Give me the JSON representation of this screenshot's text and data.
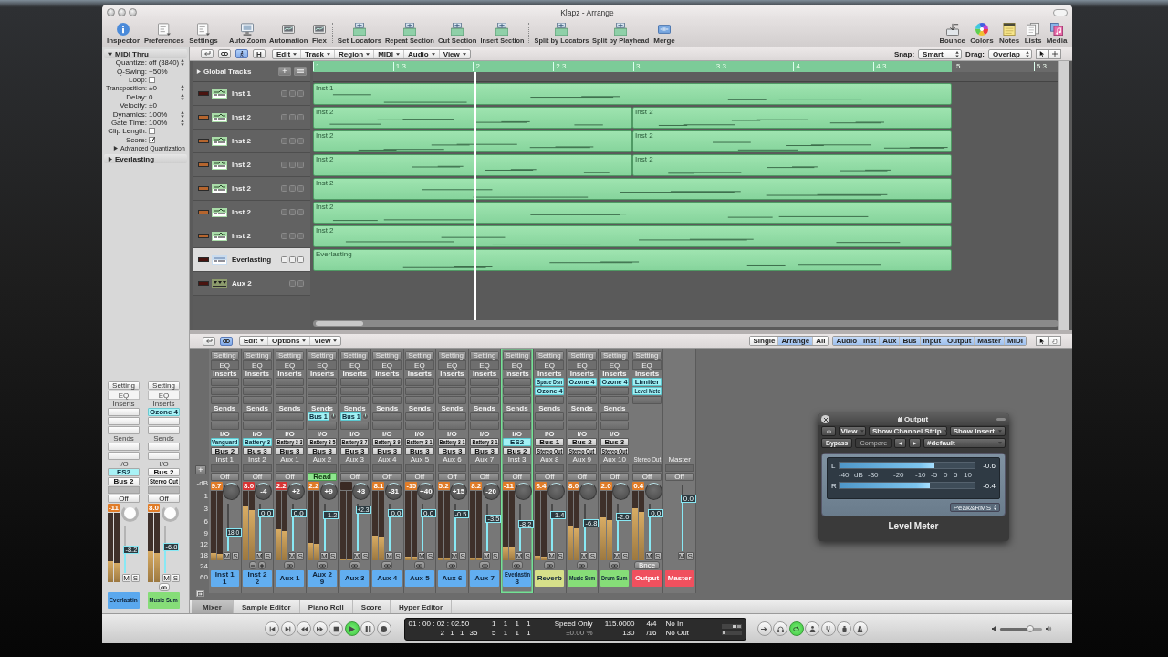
{
  "window": {
    "title": "Klapz - Arrange"
  },
  "toolbar": {
    "groups": [
      [
        {
          "label": "Inspector",
          "kind": "info"
        },
        {
          "label": "Preferences",
          "kind": "page"
        },
        {
          "label": "Settings",
          "kind": "page"
        }
      ],
      [
        {
          "label": "Auto Zoom",
          "kind": "monitor"
        },
        {
          "label": "Automation",
          "kind": "screen"
        },
        {
          "label": "Flex",
          "kind": "screen"
        }
      ],
      [
        {
          "label": "Set Locators",
          "kind": "ruler"
        },
        {
          "label": "Repeat Section",
          "kind": "ruler"
        },
        {
          "label": "Cut Section",
          "kind": "ruler"
        },
        {
          "label": "Insert Section",
          "kind": "ruler"
        }
      ],
      [
        {
          "label": "Split by Locators",
          "kind": "ruler"
        },
        {
          "label": "Split by Playhead",
          "kind": "ruler"
        },
        {
          "label": "Merge",
          "kind": "block"
        }
      ]
    ],
    "right": [
      {
        "label": "Bounce",
        "kind": "tray"
      },
      {
        "label": "Colors",
        "kind": "wheel"
      },
      {
        "label": "Notes",
        "kind": "notepad"
      },
      {
        "label": "Lists",
        "kind": "pages"
      },
      {
        "label": "Media",
        "kind": "media"
      }
    ]
  },
  "inspector": {
    "region": {
      "title": "MIDI Thru",
      "expanded": true,
      "params": [
        {
          "kind": "value",
          "label": "Quantize:",
          "value": "off (3840)",
          "stepper": true
        },
        {
          "kind": "value",
          "label": "Q-Swing:",
          "value": "+50%",
          "stepper": false
        },
        {
          "kind": "check",
          "label": "Loop:",
          "checked": false
        },
        {
          "kind": "value",
          "label": "Transposition:",
          "value": "±0",
          "stepper": true
        },
        {
          "kind": "value",
          "label": "Delay:",
          "value": "0",
          "stepper": true
        },
        {
          "kind": "value",
          "label": "Velocity:",
          "value": "±0",
          "stepper": false
        },
        {
          "kind": "value",
          "label": "Dynamics:",
          "value": "100%",
          "stepper": true
        },
        {
          "kind": "value",
          "label": "Gate Time:",
          "value": "100%",
          "stepper": true
        },
        {
          "kind": "check",
          "label": "Clip Length:",
          "checked": false
        },
        {
          "kind": "check",
          "label": "Score:",
          "checked": true
        }
      ],
      "subsection": {
        "title": "Advanced Quantization",
        "expanded": false
      }
    },
    "track": {
      "title": "Everlasting",
      "expanded": false
    },
    "strips": [
      {
        "kind": "channel",
        "setting": "Setting",
        "eq": "EQ",
        "inserts_label": "Inserts",
        "sends_label": "Sends",
        "io_label": "I/O",
        "input": {
          "label": "ES2",
          "kind": "instrument"
        },
        "output": "Bus 2",
        "automation": {
          "label": "Off",
          "active": false
        },
        "peak": {
          "value": "-11",
          "clip": false
        },
        "meter": {
          "level": 0.3
        },
        "fader": {
          "value": "-8.2",
          "level": 0.5
        },
        "mute_solo": [
          "M",
          "S"
        ],
        "label": {
          "name": "Everlastin",
          "color": "#5aa8ee"
        }
      },
      {
        "kind": "channel",
        "setting": "Setting",
        "eq": "EQ",
        "inserts_label": "Inserts",
        "inserts": [
          {
            "label": "Ozone 4"
          }
        ],
        "sends_label": "Sends",
        "io_label": "I/O",
        "input": {
          "label": "Bus 2",
          "kind": "source"
        },
        "output": "Stereo Out",
        "automation": {
          "label": "Off",
          "active": false
        },
        "peak": {
          "value": "8.0",
          "clip": false
        },
        "meter": {
          "level": 0.45
        },
        "fader": {
          "value": "-6.8",
          "level": 0.55
        },
        "mute_solo": [
          "M",
          "S"
        ],
        "footer": {
          "kind": "link"
        },
        "label": {
          "name": "Music Sum",
          "color": "#86dd78"
        }
      }
    ]
  },
  "arrange": {
    "buttons": [
      {
        "kind": "catch",
        "on": false
      },
      {
        "kind": "link",
        "on": false
      },
      {
        "kind": "figure",
        "on": true
      },
      {
        "kind": "text",
        "label": "H",
        "on": false
      }
    ],
    "menus": [
      "Edit",
      "Track",
      "Region",
      "MIDI",
      "Audio",
      "View"
    ],
    "snap": {
      "label": "Snap:",
      "value": "Smart"
    },
    "drag": {
      "label": "Drag:",
      "value": "Overlap"
    },
    "tools": [
      {
        "kind": "pointer"
      },
      {
        "kind": "crosshair"
      }
    ],
    "global_tracks": {
      "label": "Global Tracks",
      "expanded": false,
      "add_button": "+"
    },
    "ruler": {
      "level": 0.857,
      "ticks": [
        "1",
        "1.3",
        "2",
        "2.3",
        "3",
        "3.3",
        "4",
        "4.3",
        "5",
        "5.3"
      ]
    },
    "playhead": {
      "level": 0.217
    },
    "tracks": [
      {
        "name": "Inst 1",
        "kind": "inst",
        "color": "#4a1410",
        "selected": false,
        "regions": [
          {
            "name": "Inst 1"
          }
        ]
      },
      {
        "name": "Inst 2",
        "kind": "inst",
        "color": "#b5652e",
        "selected": false,
        "regions": [
          {
            "name": "Inst 2"
          },
          {
            "name": "Inst 2"
          }
        ]
      },
      {
        "name": "Inst 2",
        "kind": "inst",
        "color": "#b5652e",
        "selected": false,
        "regions": [
          {
            "name": "Inst 2"
          },
          {
            "name": "Inst 2"
          }
        ]
      },
      {
        "name": "Inst 2",
        "kind": "inst",
        "color": "#b5652e",
        "selected": false,
        "regions": [
          {
            "name": "Inst 2"
          },
          {
            "name": "Inst 2"
          }
        ]
      },
      {
        "name": "Inst 2",
        "kind": "inst",
        "color": "#b5652e",
        "selected": false,
        "regions": [
          {
            "name": "Inst 2"
          }
        ]
      },
      {
        "name": "Inst 2",
        "kind": "inst",
        "color": "#b5652e",
        "selected": false,
        "regions": [
          {
            "name": "Inst 2"
          }
        ]
      },
      {
        "name": "Inst 2",
        "kind": "inst",
        "color": "#b5652e",
        "selected": false,
        "regions": [
          {
            "name": "Inst 2"
          }
        ]
      },
      {
        "name": "Everlasting",
        "kind": "synth",
        "color": "#4a1410",
        "selected": true,
        "regions": [
          {
            "name": "Everlasting"
          }
        ]
      },
      {
        "name": "Aux 2",
        "kind": "aux",
        "color": "#4a1410",
        "selected": false
      }
    ]
  },
  "mixer": {
    "buttons": [
      {
        "kind": "catch",
        "on": false
      },
      {
        "kind": "link",
        "on": true
      }
    ],
    "menus": [
      "Edit",
      "Options",
      "View"
    ],
    "views": [
      {
        "label": "Single",
        "selected": false
      },
      {
        "label": "Arrange",
        "selected": true
      },
      {
        "label": "All",
        "selected": false
      }
    ],
    "filters": [
      {
        "label": "Audio",
        "on": true
      },
      {
        "label": "Inst",
        "on": true
      },
      {
        "label": "Aux",
        "on": true
      },
      {
        "label": "Bus",
        "on": true
      },
      {
        "label": "Input",
        "on": true
      },
      {
        "label": "Output",
        "on": true
      },
      {
        "label": "Master",
        "on": true
      },
      {
        "label": "MIDI",
        "on": true
      }
    ],
    "tools": [
      {
        "kind": "pointer"
      },
      {
        "kind": "hand"
      }
    ],
    "add_button": "+",
    "scale": [
      "-dB",
      "1",
      "3",
      "6",
      "9",
      "12",
      "18",
      "24",
      "60"
    ],
    "strips": [
      {
        "kind": "channel",
        "selected": false,
        "setting": "Setting",
        "eq": "EQ",
        "inserts_label": "Inserts",
        "sends_label": "Sends",
        "io_label": "I/O",
        "input": {
          "label": "Vanguard",
          "kind": "instrument"
        },
        "output": "Bus 2",
        "name": "Inst 1",
        "automation": {
          "label": "Off",
          "active": false
        },
        "peak": {
          "value": "9.7",
          "clip": false
        },
        "meter": {
          "level": 0.1
        },
        "fader": {
          "value": "18.0",
          "level": 0.4
        },
        "mute_solo": [
          "M",
          "S"
        ],
        "label": {
          "name": "Inst 1",
          "number": "1",
          "color": "#62aef0"
        }
      },
      {
        "kind": "channel",
        "selected": false,
        "setting": "Setting",
        "eq": "EQ",
        "inserts_label": "Inserts",
        "sends_label": "Sends",
        "io_label": "I/O",
        "input": {
          "label": "Battery 3",
          "kind": "instrument"
        },
        "output": "Bus 3",
        "name": "Inst 2",
        "automation": {
          "label": "Off",
          "active": false
        },
        "peak": {
          "value": "8.0",
          "clip": true
        },
        "pan": "-4",
        "meter": {
          "level": 0.78
        },
        "fader": {
          "value": "0.0",
          "level": 0.8
        },
        "mute_solo": [
          "M",
          "S"
        ],
        "footer": {
          "kind": "plusminus"
        },
        "label": {
          "name": "Inst 2",
          "number": "2",
          "color": "#62aef0"
        }
      },
      {
        "kind": "channel",
        "selected": false,
        "setting": "Setting",
        "eq": "EQ",
        "inserts_label": "Inserts",
        "sends_label": "Sends",
        "io_label": "I/O",
        "input": {
          "label": "Battery 3 3",
          "kind": "source"
        },
        "output": "Bus 3",
        "name": "Aux 1",
        "automation": {
          "label": "Off",
          "active": false
        },
        "peak": {
          "value": "2.2",
          "clip": true
        },
        "pan": "+2",
        "meter": {
          "level": 0.45
        },
        "fader": {
          "value": "0.0",
          "level": 0.8
        },
        "mute_solo": [
          "M",
          "S"
        ],
        "footer": {
          "kind": "link"
        },
        "label": {
          "name": "Aux 1",
          "color": "#62aef0"
        }
      },
      {
        "kind": "channel",
        "selected": false,
        "setting": "Setting",
        "eq": "EQ",
        "inserts_label": "Inserts",
        "sends_label": "Sends",
        "sends": [
          {
            "label": "Bus 1"
          }
        ],
        "io_label": "I/O",
        "input": {
          "label": "Battery 3 5",
          "kind": "source"
        },
        "output": "Bus 3",
        "name": "Aux 2",
        "automation": {
          "label": "Read",
          "active": true
        },
        "peak": {
          "value": "2.2",
          "clip": false
        },
        "pan": "+9",
        "meter": {
          "level": 0.25
        },
        "fader": {
          "value": "-1.2",
          "level": 0.76
        },
        "mute_solo": [
          "M",
          "S"
        ],
        "footer": {
          "kind": "link"
        },
        "label": {
          "name": "Aux 2",
          "number": "9",
          "color": "#62aef0"
        }
      },
      {
        "kind": "channel",
        "selected": false,
        "setting": "Setting",
        "eq": "EQ",
        "inserts_label": "Inserts",
        "sends_label": "Sends",
        "sends": [
          {
            "label": "Bus 1"
          }
        ],
        "io_label": "I/O",
        "input": {
          "label": "Battery 3 7",
          "kind": "source"
        },
        "output": "Bus 3",
        "name": "Aux 3",
        "automation": {
          "label": "Off",
          "active": false
        },
        "pan": "+3",
        "meter": {
          "level": 0
        },
        "fader": {
          "value": "+2.3",
          "level": 0.88
        },
        "mute_solo": [
          "M",
          "S"
        ],
        "footer": {
          "kind": "link"
        },
        "label": {
          "name": "Aux 3",
          "color": "#62aef0"
        }
      },
      {
        "kind": "channel",
        "selected": false,
        "setting": "Setting",
        "eq": "EQ",
        "inserts_label": "Inserts",
        "sends_label": "Sends",
        "io_label": "I/O",
        "input": {
          "label": "Battery 3 9",
          "kind": "source"
        },
        "output": "Bus 3",
        "name": "Aux 4",
        "automation": {
          "label": "Off",
          "active": false
        },
        "peak": {
          "value": "8.1",
          "clip": false
        },
        "pan": "-31",
        "meter": {
          "level": 0.35
        },
        "fader": {
          "value": "0.0",
          "level": 0.8
        },
        "mute_solo": [
          "M",
          "S"
        ],
        "footer": {
          "kind": "link"
        },
        "label": {
          "name": "Aux 4",
          "color": "#62aef0"
        }
      },
      {
        "kind": "channel",
        "selected": false,
        "setting": "Setting",
        "eq": "EQ",
        "inserts_label": "Inserts",
        "sends_label": "Sends",
        "io_label": "I/O",
        "input": {
          "label": "Battery 3 1",
          "kind": "source"
        },
        "output": "Bus 3",
        "name": "Aux 5",
        "automation": {
          "label": "Off",
          "active": false
        },
        "peak": {
          "value": "-15",
          "clip": false
        },
        "pan": "+40",
        "meter": {
          "level": 0.05
        },
        "fader": {
          "value": "0.0",
          "level": 0.8
        },
        "mute_solo": [
          "M",
          "S"
        ],
        "footer": {
          "kind": "link"
        },
        "label": {
          "name": "Aux 5",
          "color": "#62aef0"
        }
      },
      {
        "kind": "channel",
        "selected": false,
        "setting": "Setting",
        "eq": "EQ",
        "inserts_label": "Inserts",
        "sends_label": "Sends",
        "io_label": "I/O",
        "input": {
          "label": "Battery 3 1",
          "kind": "source"
        },
        "output": "Bus 3",
        "name": "Aux 6",
        "automation": {
          "label": "Off",
          "active": false
        },
        "peak": {
          "value": "5.2",
          "clip": false
        },
        "pan": "+15",
        "meter": {
          "level": 0.04
        },
        "fader": {
          "value": "-0.5",
          "level": 0.78
        },
        "mute_solo": [
          "M",
          "S"
        ],
        "footer": {
          "kind": "link"
        },
        "label": {
          "name": "Aux 6",
          "color": "#62aef0"
        }
      },
      {
        "kind": "channel",
        "selected": false,
        "setting": "Setting",
        "eq": "EQ",
        "inserts_label": "Inserts",
        "sends_label": "Sends",
        "io_label": "I/O",
        "input": {
          "label": "Battery 3 1",
          "kind": "source"
        },
        "output": "Bus 3",
        "name": "Aux 7",
        "automation": {
          "label": "Off",
          "active": false
        },
        "peak": {
          "value": "8.2",
          "clip": false
        },
        "pan": "-20",
        "meter": {
          "level": 0.04
        },
        "fader": {
          "value": "-3.5",
          "level": 0.7
        },
        "mute_solo": [
          "M",
          "S"
        ],
        "footer": {
          "kind": "link"
        },
        "label": {
          "name": "Aux 7",
          "color": "#62aef0"
        }
      },
      {
        "kind": "channel",
        "selected": true,
        "setting": "Setting",
        "eq": "EQ",
        "inserts_label": "Inserts",
        "sends_label": "Sends",
        "io_label": "I/O",
        "input": {
          "label": "ES2",
          "kind": "instrument"
        },
        "output": "Bus 2",
        "name": "Inst 3",
        "automation": {
          "label": "Off",
          "active": false
        },
        "peak": {
          "value": "-11",
          "clip": false
        },
        "meter": {
          "level": 0.2
        },
        "fader": {
          "value": "-8.2",
          "level": 0.58
        },
        "mute_solo": [
          "M",
          "S"
        ],
        "footer": {
          "kind": "link"
        },
        "label": {
          "name": "Everlastin",
          "number": "8",
          "color": "#62aef0"
        }
      },
      {
        "kind": "channel",
        "selected": false,
        "setting": "Setting",
        "eq": "EQ",
        "inserts_label": "Inserts",
        "inserts": [
          {
            "label": "Space Dsn"
          },
          {
            "label": "Ozone 4"
          }
        ],
        "sends_label": "Sends",
        "io_label": "I/O",
        "input": {
          "label": "Bus 1",
          "kind": "source"
        },
        "output": "Stereo Out",
        "name": "Aux 8",
        "automation": {
          "label": "Off",
          "active": false
        },
        "peak": {
          "value": "6.4",
          "clip": false
        },
        "meter": {
          "level": 0.06
        },
        "fader": {
          "value": "-1.4",
          "level": 0.76
        },
        "mute_solo": [
          "M",
          "S"
        ],
        "footer": {
          "kind": "link"
        },
        "label": {
          "name": "Reverb",
          "color": "#d6df8a"
        }
      },
      {
        "kind": "channel",
        "selected": false,
        "setting": "Setting",
        "eq": "EQ",
        "inserts_label": "Inserts",
        "inserts": [
          {
            "label": "Ozone 4"
          }
        ],
        "sends_label": "Sends",
        "io_label": "I/O",
        "input": {
          "label": "Bus 2",
          "kind": "source"
        },
        "output": "Stereo Out",
        "name": "Aux 9",
        "automation": {
          "label": "Off",
          "active": false
        },
        "peak": {
          "value": "8.0",
          "clip": false
        },
        "meter": {
          "level": 0.5
        },
        "fader": {
          "value": "-6.8",
          "level": 0.6
        },
        "mute_solo": [
          "M",
          "S"
        ],
        "footer": {
          "kind": "link"
        },
        "label": {
          "name": "Music Sum",
          "color": "#86dd78"
        }
      },
      {
        "kind": "channel",
        "selected": false,
        "setting": "Setting",
        "eq": "EQ",
        "inserts_label": "Inserts",
        "inserts": [
          {
            "label": "Ozone 4"
          }
        ],
        "sends_label": "Sends",
        "io_label": "I/O",
        "input": {
          "label": "Bus 3",
          "kind": "source"
        },
        "output": "Stereo Out",
        "name": "Aux 10",
        "automation": {
          "label": "Off",
          "active": false
        },
        "peak": {
          "value": "2.0",
          "clip": false
        },
        "meter": {
          "level": 0.62
        },
        "fader": {
          "value": "-2.0",
          "level": 0.73
        },
        "mute_solo": [
          "M",
          "S"
        ],
        "footer": {
          "kind": "link"
        },
        "label": {
          "name": "Drum Sum",
          "color": "#86dd78"
        }
      },
      {
        "kind": "output",
        "selected": false,
        "setting": "Setting",
        "eq": "EQ",
        "inserts_label": "Inserts",
        "inserts": [
          {
            "label": "Limiter"
          },
          {
            "label": "Level Mete"
          }
        ],
        "name": "Stereo Out",
        "automation": {
          "label": "Off",
          "active": false
        },
        "peak": {
          "value": "0.4",
          "clip": false
        },
        "meter": {
          "level": 0.75
        },
        "fader": {
          "value": "0.0",
          "level": 0.8
        },
        "mute_solo": [
          "M",
          "S"
        ],
        "footer": {
          "kind": "button",
          "label": "Bnce"
        },
        "label": {
          "name": "Output",
          "color": "#f0505e"
        }
      },
      {
        "kind": "master",
        "selected": false,
        "name": "Master",
        "automation": {
          "label": "Off",
          "active": false
        },
        "fader": {
          "value": "0.0",
          "level": 0.8
        },
        "mute_solo": [
          "M",
          "S"
        ],
        "label": {
          "name": "Master",
          "color": "#f0505e"
        }
      }
    ],
    "tabs": [
      {
        "label": "Mixer",
        "selected": true
      },
      {
        "label": "Sample Editor",
        "selected": false
      },
      {
        "label": "Piano Roll",
        "selected": false
      },
      {
        "label": "Score",
        "selected": false
      },
      {
        "label": "Hyper Editor",
        "selected": false
      }
    ]
  },
  "plugin_window": {
    "title": "Output",
    "menus": [
      "View",
      "Show Channel Strip",
      "Show Insert"
    ],
    "bypass": "Bypass",
    "compare": {
      "label": "Compare",
      "disabled": true
    },
    "preset": "#default",
    "meters": [
      {
        "channel": "L",
        "level": 0.7,
        "reading": "-0.6"
      },
      {
        "channel": "R",
        "level": 0.67,
        "reading": "-0.4"
      }
    ],
    "scale": [
      "-40",
      "dB",
      "-30",
      "-20",
      "-10",
      "-5",
      "0",
      "5",
      "10"
    ],
    "mode": "Peak&RMS",
    "name": "Level Meter"
  },
  "transport": {
    "buttons": [
      {
        "kind": "start",
        "on": false
      },
      {
        "kind": "end",
        "on": false
      },
      {
        "kind": "rewind",
        "on": false
      },
      {
        "kind": "forward",
        "on": false
      },
      {
        "kind": "stop",
        "on": false
      },
      {
        "kind": "play",
        "on": true
      },
      {
        "kind": "pause",
        "on": false
      },
      {
        "kind": "record",
        "on": false
      }
    ],
    "lcd": [
      [
        {
          "text": "01 : 00 : 02 : 02.50",
          "dim": false
        },
        {
          "text": "2 1 1 35",
          "dim": false
        }
      ],
      [
        {
          "text": "1 1 1 1",
          "dim": false
        },
        {
          "text": "5 1 1 1",
          "dim": false
        }
      ],
      [
        {
          "text": "Speed Only",
          "dim": false
        },
        {
          "text": "±0.00 %",
          "dim": true
        }
      ],
      [
        {
          "text": "115.0000",
          "dim": false
        },
        {
          "text": "130",
          "dim": false
        }
      ],
      [
        {
          "text": "4/4",
          "dim": false
        },
        {
          "text": "/16",
          "dim": false
        }
      ],
      [
        {
          "text": "No In",
          "dim": false
        },
        {
          "text": "No Out",
          "dim": false
        }
      ]
    ],
    "modes": [
      {
        "kind": "replace",
        "on": false
      },
      {
        "kind": "headphones",
        "on": false
      },
      {
        "kind": "cycle",
        "on": true
      },
      {
        "kind": "figure",
        "on": false
      },
      {
        "kind": "tuner",
        "on": false
      },
      {
        "kind": "solo",
        "on": false
      },
      {
        "kind": "metronome",
        "on": false
      }
    ],
    "volume": {
      "level": 0.72
    }
  }
}
